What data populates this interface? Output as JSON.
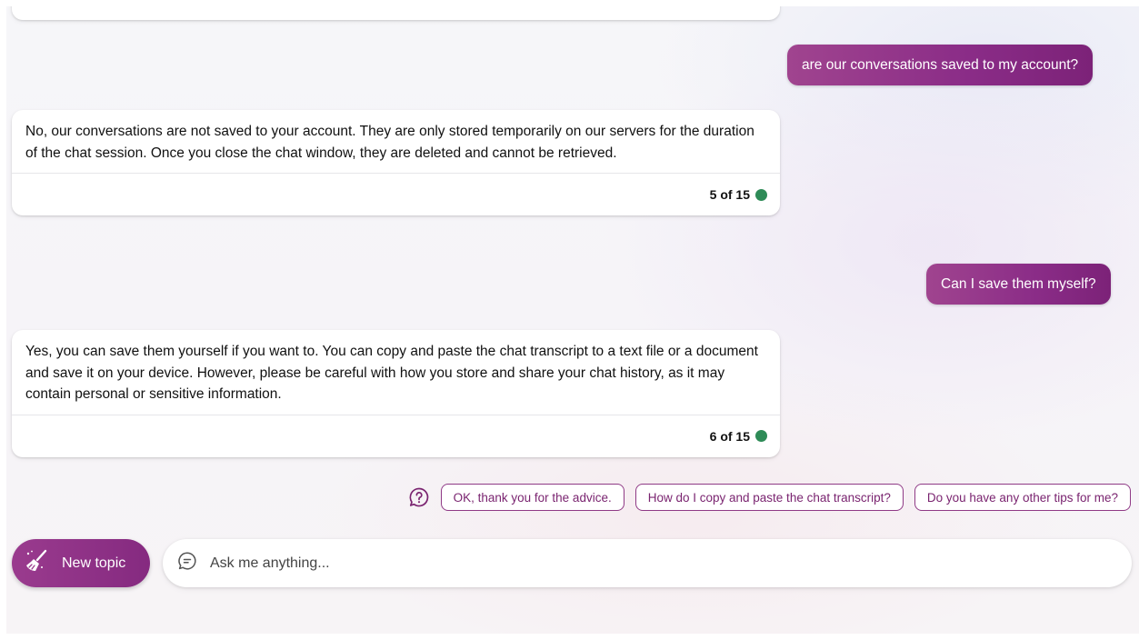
{
  "conversation": {
    "messages": [
      {
        "role": "user",
        "text": "are our conversations saved to my account?"
      },
      {
        "role": "bot",
        "text": "No, our conversations are not saved to your account. They are only stored temporarily on our servers for the duration of the chat session. Once you close the chat window, they are deleted and cannot be retrieved.",
        "counter": "5 of 15"
      },
      {
        "role": "user",
        "text": "Can I save them myself?"
      },
      {
        "role": "bot",
        "text": "Yes, you can save them yourself if you want to. You can copy and paste the chat transcript to a text file or a document and save it on your device. However, please be careful with how you store and share your chat history, as it may contain personal or sensitive information.",
        "counter": "6 of 15"
      }
    ]
  },
  "suggestions": {
    "items": [
      "OK, thank you for the advice.",
      "How do I copy and paste the chat transcript?",
      "Do you have any other tips for me?"
    ]
  },
  "composer": {
    "new_topic_label": "New topic",
    "placeholder": "Ask me anything..."
  },
  "colors": {
    "accent": "#8a2c87",
    "counter_dot": "#2e8b57"
  },
  "icons": {
    "help": "help-circle-icon",
    "new_topic": "broom-icon",
    "chat": "chat-bubble-icon"
  }
}
